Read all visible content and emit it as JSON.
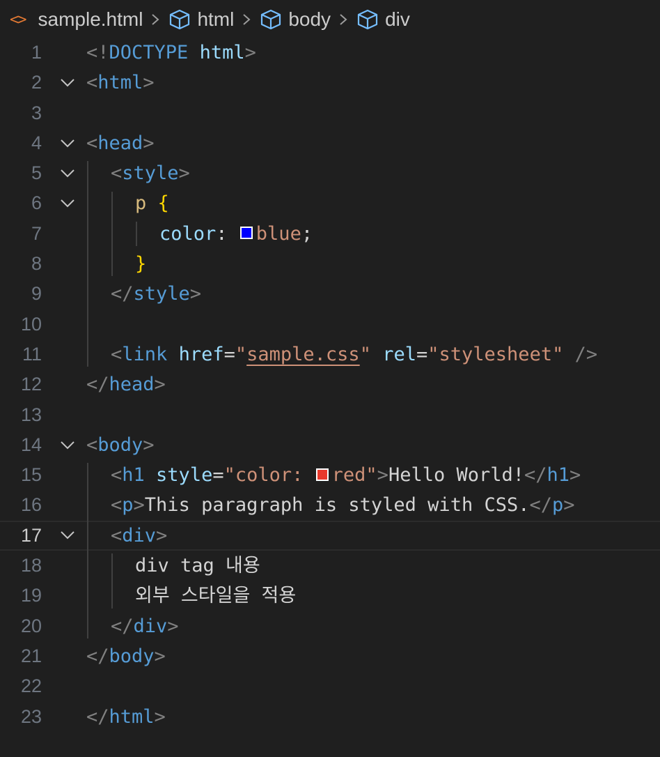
{
  "breadcrumb": {
    "file": "sample.html",
    "items": [
      "html",
      "body",
      "div"
    ]
  },
  "colors": {
    "background": "#1f1f1f",
    "tag": "#569cd6",
    "attribute": "#9cdcfe",
    "string": "#ce9178",
    "selector": "#d7ba7d",
    "brace": "#ffd700",
    "swatch_blue": "#0000ff",
    "swatch_red": "#e8392c"
  },
  "editor": {
    "current_line": 17,
    "lines": [
      {
        "n": "1",
        "fold": false,
        "indent": 0,
        "tokens": [
          [
            "b",
            "<!"
          ],
          [
            "t",
            "DOCTYPE"
          ],
          [
            "x",
            " "
          ],
          [
            "a",
            "html"
          ],
          [
            "b",
            ">"
          ]
        ]
      },
      {
        "n": "2",
        "fold": true,
        "indent": 0,
        "tokens": [
          [
            "b",
            "<"
          ],
          [
            "t",
            "html"
          ],
          [
            "b",
            ">"
          ]
        ]
      },
      {
        "n": "3",
        "fold": false,
        "indent": 0,
        "tokens": []
      },
      {
        "n": "4",
        "fold": true,
        "indent": 0,
        "tokens": [
          [
            "b",
            "<"
          ],
          [
            "t",
            "head"
          ],
          [
            "b",
            ">"
          ]
        ]
      },
      {
        "n": "5",
        "fold": true,
        "indent": 1,
        "tokens": [
          [
            "b",
            "<"
          ],
          [
            "t",
            "style"
          ],
          [
            "b",
            ">"
          ]
        ]
      },
      {
        "n": "6",
        "fold": true,
        "indent": 2,
        "tokens": [
          [
            "s",
            "p"
          ],
          [
            "x",
            " "
          ],
          [
            "c",
            "{"
          ]
        ]
      },
      {
        "n": "7",
        "fold": false,
        "indent": 3,
        "tokens": [
          [
            "a",
            "color"
          ],
          [
            "x",
            ": "
          ],
          [
            "sw",
            "#0000ff"
          ],
          [
            "r",
            "blue"
          ],
          [
            "x",
            ";"
          ]
        ]
      },
      {
        "n": "8",
        "fold": false,
        "indent": 2,
        "tokens": [
          [
            "c",
            "}"
          ]
        ]
      },
      {
        "n": "9",
        "fold": false,
        "indent": 1,
        "tokens": [
          [
            "b",
            "</"
          ],
          [
            "t",
            "style"
          ],
          [
            "b",
            ">"
          ]
        ]
      },
      {
        "n": "10",
        "fold": false,
        "indent": 0,
        "tokens": []
      },
      {
        "n": "11",
        "fold": false,
        "indent": 1,
        "tokens": [
          [
            "b",
            "<"
          ],
          [
            "t",
            "link"
          ],
          [
            "x",
            " "
          ],
          [
            "a",
            "href"
          ],
          [
            "x",
            "="
          ],
          [
            "r",
            "\""
          ],
          [
            "u",
            "sample.css"
          ],
          [
            "r",
            "\""
          ],
          [
            "x",
            " "
          ],
          [
            "a",
            "rel"
          ],
          [
            "x",
            "="
          ],
          [
            "r",
            "\"stylesheet\""
          ],
          [
            "x",
            " "
          ],
          [
            "b",
            "/>"
          ]
        ]
      },
      {
        "n": "12",
        "fold": false,
        "indent": 0,
        "tokens": [
          [
            "b",
            "</"
          ],
          [
            "t",
            "head"
          ],
          [
            "b",
            ">"
          ]
        ]
      },
      {
        "n": "13",
        "fold": false,
        "indent": 0,
        "tokens": []
      },
      {
        "n": "14",
        "fold": true,
        "indent": 0,
        "tokens": [
          [
            "b",
            "<"
          ],
          [
            "t",
            "body"
          ],
          [
            "b",
            ">"
          ]
        ]
      },
      {
        "n": "15",
        "fold": false,
        "indent": 1,
        "tokens": [
          [
            "b",
            "<"
          ],
          [
            "t",
            "h1"
          ],
          [
            "x",
            " "
          ],
          [
            "a",
            "style"
          ],
          [
            "x",
            "="
          ],
          [
            "r",
            "\"color: "
          ],
          [
            "sw",
            "#e8392c"
          ],
          [
            "r",
            "red\""
          ],
          [
            "b",
            ">"
          ],
          [
            "x",
            "Hello World!"
          ],
          [
            "b",
            "</"
          ],
          [
            "t",
            "h1"
          ],
          [
            "b",
            ">"
          ]
        ]
      },
      {
        "n": "16",
        "fold": false,
        "indent": 1,
        "tokens": [
          [
            "b",
            "<"
          ],
          [
            "t",
            "p"
          ],
          [
            "b",
            ">"
          ],
          [
            "x",
            "This paragraph is styled with CSS."
          ],
          [
            "b",
            "</"
          ],
          [
            "t",
            "p"
          ],
          [
            "b",
            ">"
          ]
        ]
      },
      {
        "n": "17",
        "fold": true,
        "indent": 1,
        "tokens": [
          [
            "b",
            "<"
          ],
          [
            "t",
            "div"
          ],
          [
            "b",
            ">"
          ]
        ]
      },
      {
        "n": "18",
        "fold": false,
        "indent": 2,
        "tokens": [
          [
            "x",
            "div tag 내용"
          ]
        ]
      },
      {
        "n": "19",
        "fold": false,
        "indent": 2,
        "tokens": [
          [
            "x",
            "외부 스타일을 적용"
          ]
        ]
      },
      {
        "n": "20",
        "fold": false,
        "indent": 1,
        "tokens": [
          [
            "b",
            "</"
          ],
          [
            "t",
            "div"
          ],
          [
            "b",
            ">"
          ]
        ]
      },
      {
        "n": "21",
        "fold": false,
        "indent": 0,
        "tokens": [
          [
            "b",
            "</"
          ],
          [
            "t",
            "body"
          ],
          [
            "b",
            ">"
          ]
        ]
      },
      {
        "n": "22",
        "fold": false,
        "indent": 0,
        "tokens": []
      },
      {
        "n": "23",
        "fold": false,
        "indent": 0,
        "tokens": [
          [
            "b",
            "</"
          ],
          [
            "t",
            "html"
          ],
          [
            "b",
            ">"
          ]
        ]
      }
    ]
  }
}
